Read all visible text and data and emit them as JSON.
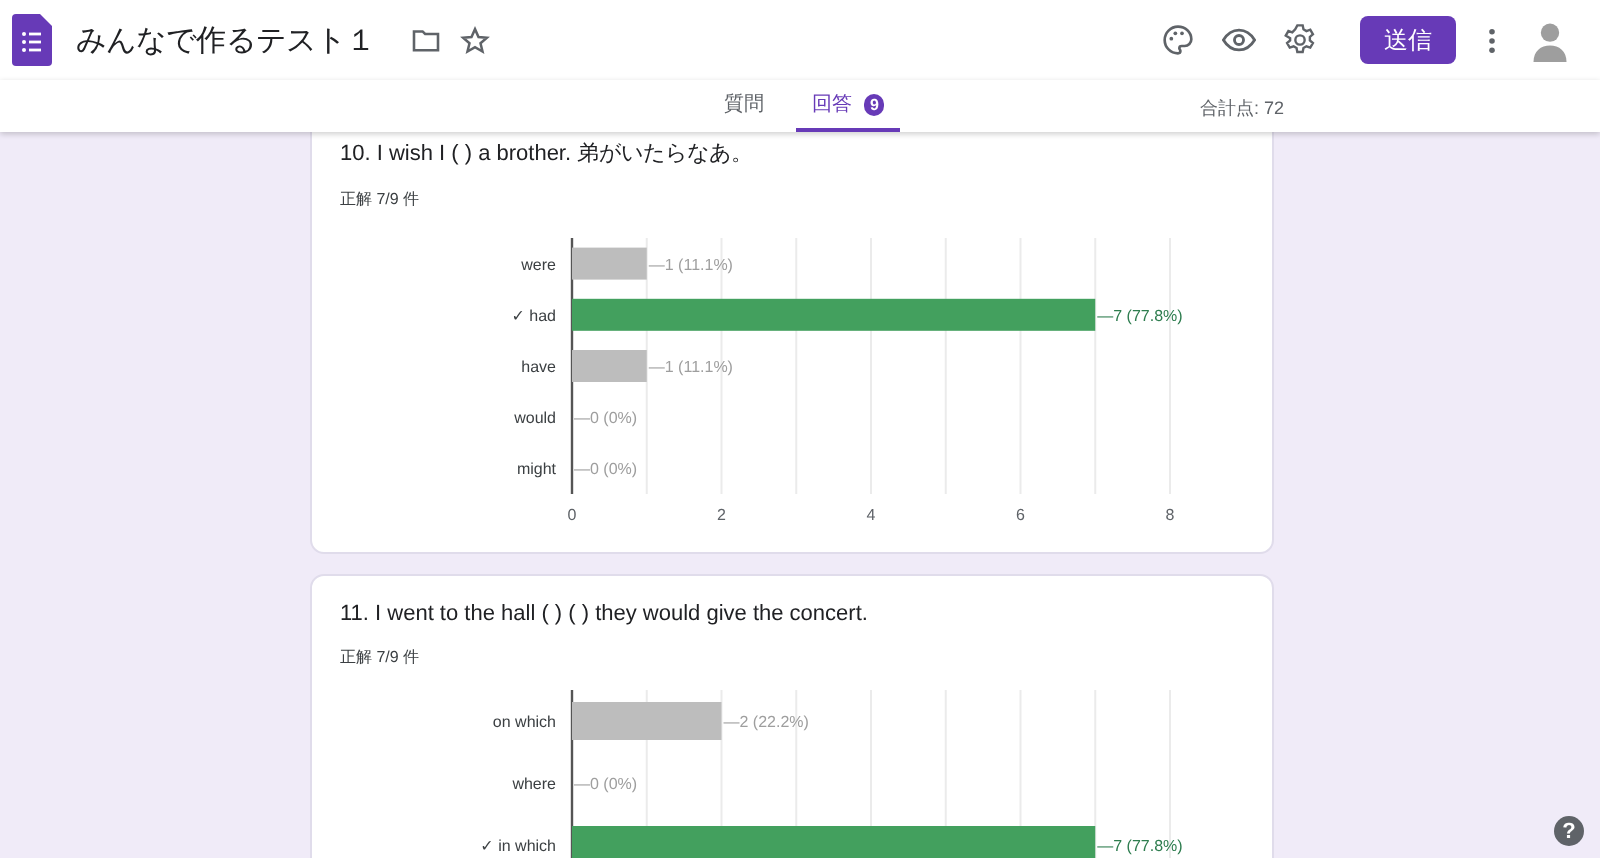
{
  "header": {
    "title": "みんなで作るテスト１",
    "send_button": "送信"
  },
  "tabs": [
    {
      "label": "質問",
      "selected": false
    },
    {
      "label": "回答",
      "selected": true,
      "badge": "9"
    }
  ],
  "total_points": "合計点: 72",
  "questions": [
    {
      "title": "10. I wish I ( ) a brother. 弟がいたらなあ。",
      "score": "正解 7/9 件",
      "chart_data": {
        "type": "bar",
        "orientation": "horizontal",
        "grid": true,
        "categories": [
          "were",
          "✓ had",
          "have",
          "would",
          "might"
        ],
        "series": [
          {
            "color": "#bdbdbd",
            "values": [
              1,
              null,
              1,
              0,
              0
            ]
          },
          {
            "color": "#43a05e",
            "values": [
              null,
              7,
              null,
              null,
              null
            ]
          }
        ],
        "value_labels": [
          "—1 (11.1%)",
          "—7 (77.8%)",
          "—1 (11.1%)",
          "—0 (0%)",
          "—0 (0%)"
        ],
        "xlim": [
          0,
          8
        ],
        "xticks": [
          0,
          2,
          4,
          6,
          8
        ]
      }
    },
    {
      "title": "11. I went to the hall ( ) ( ) they would give the concert.",
      "score": "正解 7/9 件",
      "chart_data": {
        "type": "bar",
        "orientation": "horizontal",
        "grid": true,
        "categories": [
          "on which",
          "where",
          "✓ in which"
        ],
        "series": [
          {
            "color": "#bdbdbd",
            "values": [
              2,
              0,
              null
            ]
          },
          {
            "color": "#43a05e",
            "values": [
              null,
              null,
              7
            ]
          }
        ],
        "value_labels": [
          "—2 (22.2%)",
          "—0 (0%)",
          "—7 (77.8%)"
        ],
        "xlim": [
          0,
          8
        ]
      }
    }
  ],
  "help": "?"
}
